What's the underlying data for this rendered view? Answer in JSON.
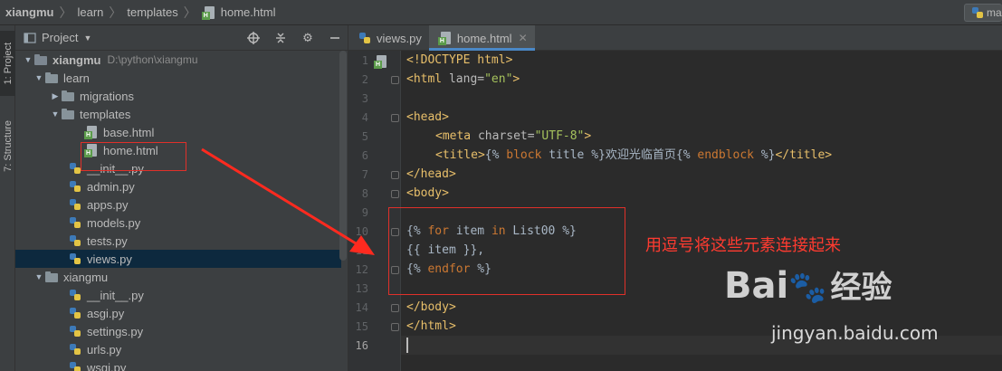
{
  "breadcrumb": {
    "items": [
      "xiangmu",
      "learn",
      "templates",
      "home.html"
    ],
    "right_truncated": "ma"
  },
  "toolstrip": {
    "project_tab": "1: Project",
    "structure_tab": "7: Structure"
  },
  "project_panel": {
    "title": "Project",
    "tree": [
      {
        "label": "xiangmu",
        "path": "D:\\python\\xiangmu",
        "type": "folder",
        "depth": 0,
        "expanded": true,
        "bold": true
      },
      {
        "label": "learn",
        "type": "folder",
        "depth": 1,
        "expanded": true
      },
      {
        "label": "migrations",
        "type": "folder",
        "depth": 2,
        "expanded": false
      },
      {
        "label": "templates",
        "type": "folder",
        "depth": 2,
        "expanded": true
      },
      {
        "label": "base.html",
        "type": "html",
        "depth": 3
      },
      {
        "label": "home.html",
        "type": "html",
        "depth": 3
      },
      {
        "label": "__init__.py",
        "type": "py",
        "depth": 2
      },
      {
        "label": "admin.py",
        "type": "py",
        "depth": 2
      },
      {
        "label": "apps.py",
        "type": "py",
        "depth": 2
      },
      {
        "label": "models.py",
        "type": "py",
        "depth": 2
      },
      {
        "label": "tests.py",
        "type": "py",
        "depth": 2
      },
      {
        "label": "views.py",
        "type": "py",
        "depth": 2,
        "selected": true
      },
      {
        "label": "xiangmu",
        "type": "folder",
        "depth": 1,
        "expanded": true
      },
      {
        "label": "__init__.py",
        "type": "py",
        "depth": 2
      },
      {
        "label": "asgi.py",
        "type": "py",
        "depth": 2
      },
      {
        "label": "settings.py",
        "type": "py",
        "depth": 2
      },
      {
        "label": "urls.py",
        "type": "py",
        "depth": 2
      },
      {
        "label": "wsgi.py",
        "type": "py",
        "depth": 2
      }
    ]
  },
  "editor": {
    "tabs": [
      {
        "label": "views.py",
        "type": "py",
        "active": false
      },
      {
        "label": "home.html",
        "type": "html",
        "active": true
      }
    ],
    "lines": [
      "1",
      "2",
      "3",
      "4",
      "5",
      "6",
      "7",
      "8",
      "9",
      "10",
      "11",
      "12",
      "13",
      "14",
      "15",
      "16"
    ],
    "code": {
      "l1": "<!DOCTYPE html>",
      "l2a": "<html ",
      "l2b": "lang=",
      "l2c": "\"en\"",
      "l2d": ">",
      "l4": "<head>",
      "l5a": "<meta ",
      "l5b": "charset=",
      "l5c": "\"UTF-8\"",
      "l5d": ">",
      "l6a": "<title>",
      "l6b": "{% ",
      "l6c": "block ",
      "l6d": "title %}",
      "l6e": "欢迎光临首页",
      "l6f": "{% ",
      "l6g": "endblock ",
      "l6h": "%}",
      "l6i": "</title>",
      "l7": "</head>",
      "l8": "<body>",
      "l10a": "{% ",
      "l10b": "for ",
      "l10c": "item ",
      "l10d": "in ",
      "l10e": "List00 %}",
      "l11": "{{ item }},",
      "l12a": "{% ",
      "l12b": "endfor ",
      "l12c": "%}",
      "l14": "</body>",
      "l15": "</html>"
    }
  },
  "annotation": {
    "text": "用逗号将这些元素连接起来",
    "color": "#e0302a"
  },
  "watermark": {
    "logo_left": "Bai",
    "logo_right": "经验",
    "url": "jingyan.baidu.com"
  }
}
